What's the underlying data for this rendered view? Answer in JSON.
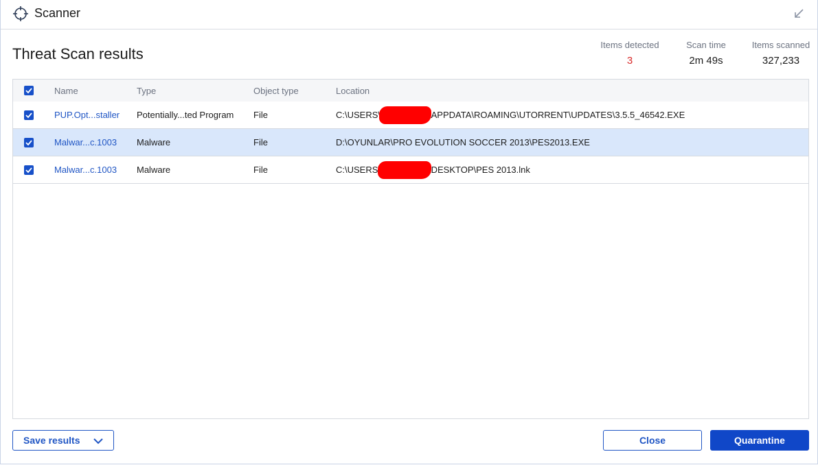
{
  "window": {
    "title": "Scanner",
    "app_icon": "crosshair-icon",
    "minimize_icon": "arrow-down-left-icon"
  },
  "page_title": "Threat Scan results",
  "stats": {
    "detected": {
      "label": "Items detected",
      "value": "3",
      "color": "#d92b2b"
    },
    "time": {
      "label": "Scan time",
      "value": "2m 49s"
    },
    "scanned": {
      "label": "Items scanned",
      "value": "327,233"
    }
  },
  "table": {
    "columns": [
      "Name",
      "Type",
      "Object type",
      "Location"
    ],
    "rows": [
      {
        "checked": true,
        "name": "PUP.Opt...staller",
        "type": "Potentially...ted Program",
        "object_type": "File",
        "location_prefix": "C:\\USERS\\",
        "location_suffix": "\\APPDATA\\ROAMING\\UTORRENT\\UPDATES\\3.5.5_46542.EXE"
      },
      {
        "checked": true,
        "selected": true,
        "name": "Malwar...c.1003",
        "type": "Malware",
        "object_type": "File",
        "location_prefix": "D:\\OYUNLAR\\PRO EVOLUTION SOCCER 2013\\PES2013.EXE",
        "location_suffix": ""
      },
      {
        "checked": true,
        "name": "Malwar...c.1003",
        "type": "Malware",
        "object_type": "File",
        "location_prefix": "C:\\USERS\\",
        "location_suffix": "\\DESKTOP\\PES 2013.lnk"
      }
    ]
  },
  "footer": {
    "save_label": "Save results",
    "close_label": "Close",
    "quarantine_label": "Quarantine"
  },
  "colors": {
    "accent": "#1047c8",
    "link": "#1f55c4",
    "selected_row": "#d9e7fb",
    "redaction": "#ff0000"
  }
}
